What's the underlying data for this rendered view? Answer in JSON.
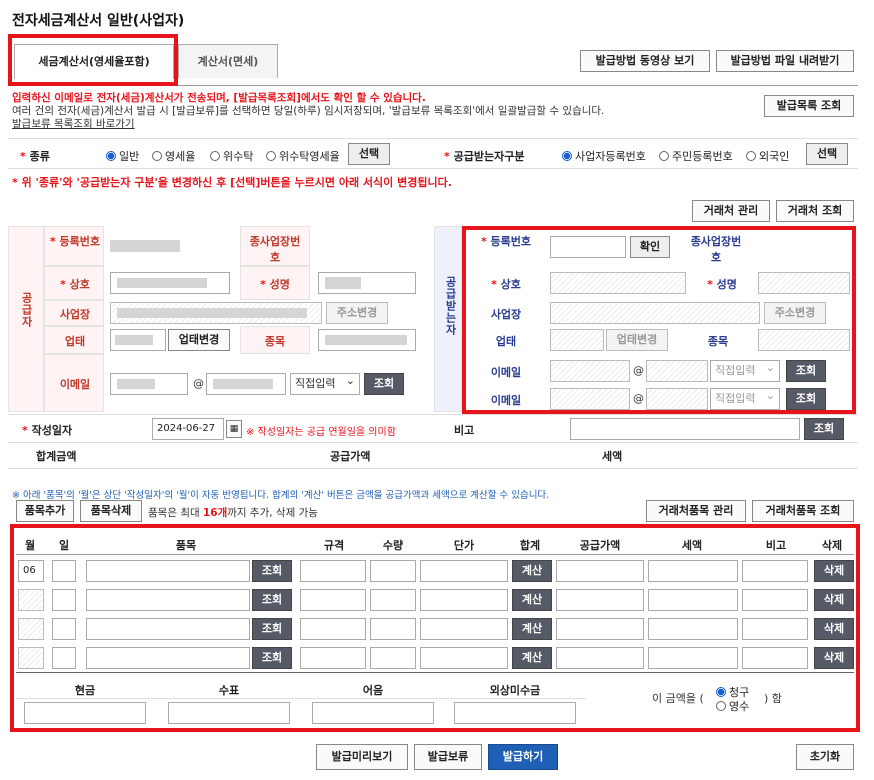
{
  "page_title": "전자세금계산서 일반(사업자)",
  "tabs": [
    {
      "label": "세금계산서(영세율포함)"
    },
    {
      "label": "계산서(면세)"
    }
  ],
  "top_buttons": {
    "video": "발급방법 동영상 보기",
    "file": "발급방법 파일 내려받기",
    "list": "발급목록 조회"
  },
  "notice": {
    "line1": "입력하신 이메일로 전자(세금)계산서가 전송되며, [발급목록조회]에서도 확인 할 수 있습니다.",
    "line2": "여러 건의 전자(세금)계산서 발급 시 [발급보류]를 선택하면 당일(하루) 임시저장되며, '발급보류 목록조회'에서 일괄발급할 수 있습니다.",
    "line3": "발급보류 목록조회 바로가기"
  },
  "type_row": {
    "type_label": "종류",
    "type_options": [
      "일반",
      "영세율",
      "위수탁",
      "위수탁영세율"
    ],
    "select": "선택",
    "recv_label": "공급받는자구분",
    "recv_options": [
      "사업자등록번호",
      "주민등록번호",
      "외국인"
    ],
    "select2": "선택",
    "warning": "* 위 '종류'와 '공급받는자 구분'을 변경하신 후 [선택]버튼을 누르시면 아래 서식이 변경됩니다."
  },
  "partner_buttons": {
    "manage": "거래처 관리",
    "lookup": "거래처 조회"
  },
  "supplier": {
    "side_label": "공급자",
    "reg_no": "등록번호",
    "sub_no": "종사업장번호",
    "name": "상호",
    "ceo": "성명",
    "addr": "사업장",
    "addr_btn": "주소변경",
    "biz": "업태",
    "biz_btn": "업태변경",
    "item": "종목",
    "email": "이메일",
    "at": "@",
    "direct": "직접입력",
    "lookup": "조회"
  },
  "receiver": {
    "side_label": "공급받는자",
    "reg_no": "등록번호",
    "confirm": "확인",
    "sub_no": "종사업장번호",
    "name": "상호",
    "ceo": "성명",
    "addr": "사업장",
    "addr_btn": "주소변경",
    "biz": "업태",
    "biz_btn": "업태변경",
    "item": "종목",
    "email": "이메일",
    "at": "@",
    "direct": "직접입력",
    "lookup": "조회"
  },
  "date_row": {
    "label": "작성일자",
    "date": "2024-06-27",
    "note": "※ 작성일자는 공급 연월일을 의미함",
    "remark": "비고",
    "lookup": "조회"
  },
  "total_row": {
    "total": "합계금액",
    "supply": "공급가액",
    "tax": "세액"
  },
  "items_note": "※ 아래 '품목'의 '월'은 상단 '작성일자'의 '월'이 자동 반영됩니다. 합계의 '계산' 버튼은 금액을 공급가액과 세액으로 계산할 수 있습니다.",
  "items_toolbar": {
    "add": "품목추가",
    "del": "품목삭제",
    "limit_a": "품목은 최대 ",
    "limit_b": "16개",
    "limit_c": "까지 추가, 삭제 가능",
    "manage": "거래처품목 관리",
    "lookup": "거래처품목 조회"
  },
  "items_header": [
    "월",
    "일",
    "품목",
    "규격",
    "수량",
    "단가",
    "합계",
    "공급가액",
    "세액",
    "비고",
    "삭제"
  ],
  "items_rows": [
    {
      "month": "06"
    },
    {
      "month": ""
    },
    {
      "month": ""
    },
    {
      "month": ""
    }
  ],
  "row_buttons": {
    "lookup": "조회",
    "calc": "계산",
    "del": "삭제"
  },
  "payment_header": [
    "현금",
    "수표",
    "어음",
    "외상미수금"
  ],
  "payment_note": {
    "prefix": "이 금액을 (",
    "claim": "청구",
    "receipt": "영수",
    "suffix": ") 함"
  },
  "bottom_buttons": {
    "preview": "발급미리보기",
    "hold": "발급보류",
    "issue": "발급하기",
    "reset": "초기화"
  }
}
